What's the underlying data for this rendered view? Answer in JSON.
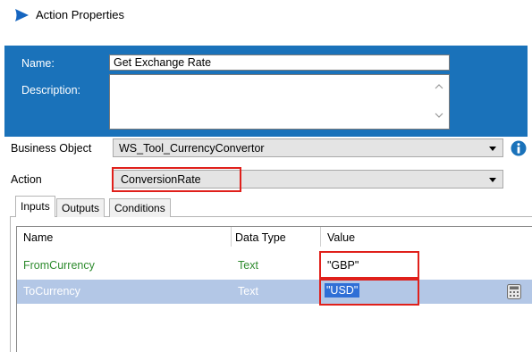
{
  "window": {
    "title": "Action Properties",
    "icon": "blueprism-logo-icon"
  },
  "header": {
    "name_label": "Name:",
    "name_value": "Get Exchange Rate",
    "description_label": "Description:",
    "description_value": ""
  },
  "business_object": {
    "label": "Business Object",
    "value": "WS_Tool_CurrencyConvertor"
  },
  "action": {
    "label": "Action",
    "value": "ConversionRate"
  },
  "tabs": [
    {
      "label": "Inputs",
      "active": true
    },
    {
      "label": "Outputs",
      "active": false
    },
    {
      "label": "Conditions",
      "active": false
    }
  ],
  "grid": {
    "columns": [
      "Name",
      "Data Type",
      "Value"
    ],
    "rows": [
      {
        "name": "FromCurrency",
        "type": "Text",
        "value": "\"GBP\"",
        "selected": false
      },
      {
        "name": "ToCurrency",
        "type": "Text",
        "value": "\"USD\"",
        "selected": true
      }
    ]
  },
  "colors": {
    "header_blue": "#1a72ba",
    "highlight_red": "#e0201b",
    "selected_row": "#b3c7e6",
    "name_green": "#2e8b2e"
  }
}
